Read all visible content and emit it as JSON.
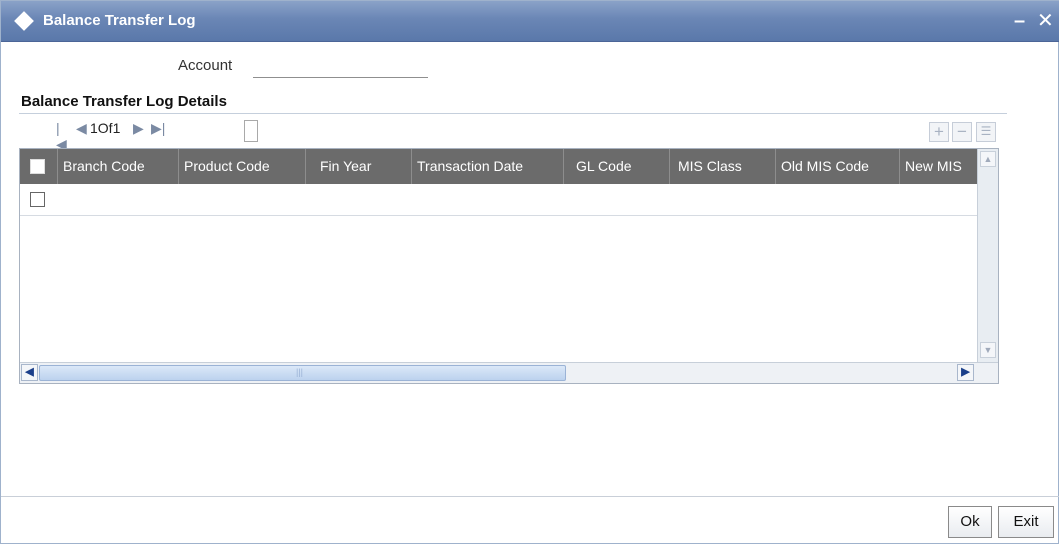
{
  "window": {
    "title": "Balance Transfer Log",
    "minimize_glyph": "–",
    "close_glyph": "✕"
  },
  "form": {
    "account_label": "Account",
    "account_value": ""
  },
  "section": {
    "title": "Balance Transfer Log Details"
  },
  "pager": {
    "first_glyph": "|◀",
    "prev_glyph": "◀",
    "page_text": "1Of1",
    "next_glyph": "▶",
    "last_glyph": "▶|",
    "page_input_value": ""
  },
  "toolbar": {
    "add_glyph": "+",
    "delete_glyph": "−",
    "view_glyph": "☰"
  },
  "grid": {
    "columns": [
      "Branch Code",
      "Product Code",
      "Fin Year",
      "Transaction Date",
      "GL Code",
      "MIS Class",
      "Old MIS Code",
      "New MIS"
    ],
    "rows": [
      {
        "checked": false,
        "cells": [
          "",
          "",
          "",
          "",
          "",
          "",
          "",
          ""
        ]
      }
    ],
    "scroll_up_glyph": "▲",
    "scroll_down_glyph": "▼",
    "scroll_left_glyph": "◀",
    "scroll_right_glyph": "▶",
    "scroll_grip_glyph": "|||"
  },
  "buttons": {
    "ok_label": "Ok",
    "exit_label": "Exit"
  },
  "colors": {
    "titlebar": "#6a86b5",
    "grid_header": "#6b6b6b",
    "scroll_thumb": "#bcd2ee"
  }
}
